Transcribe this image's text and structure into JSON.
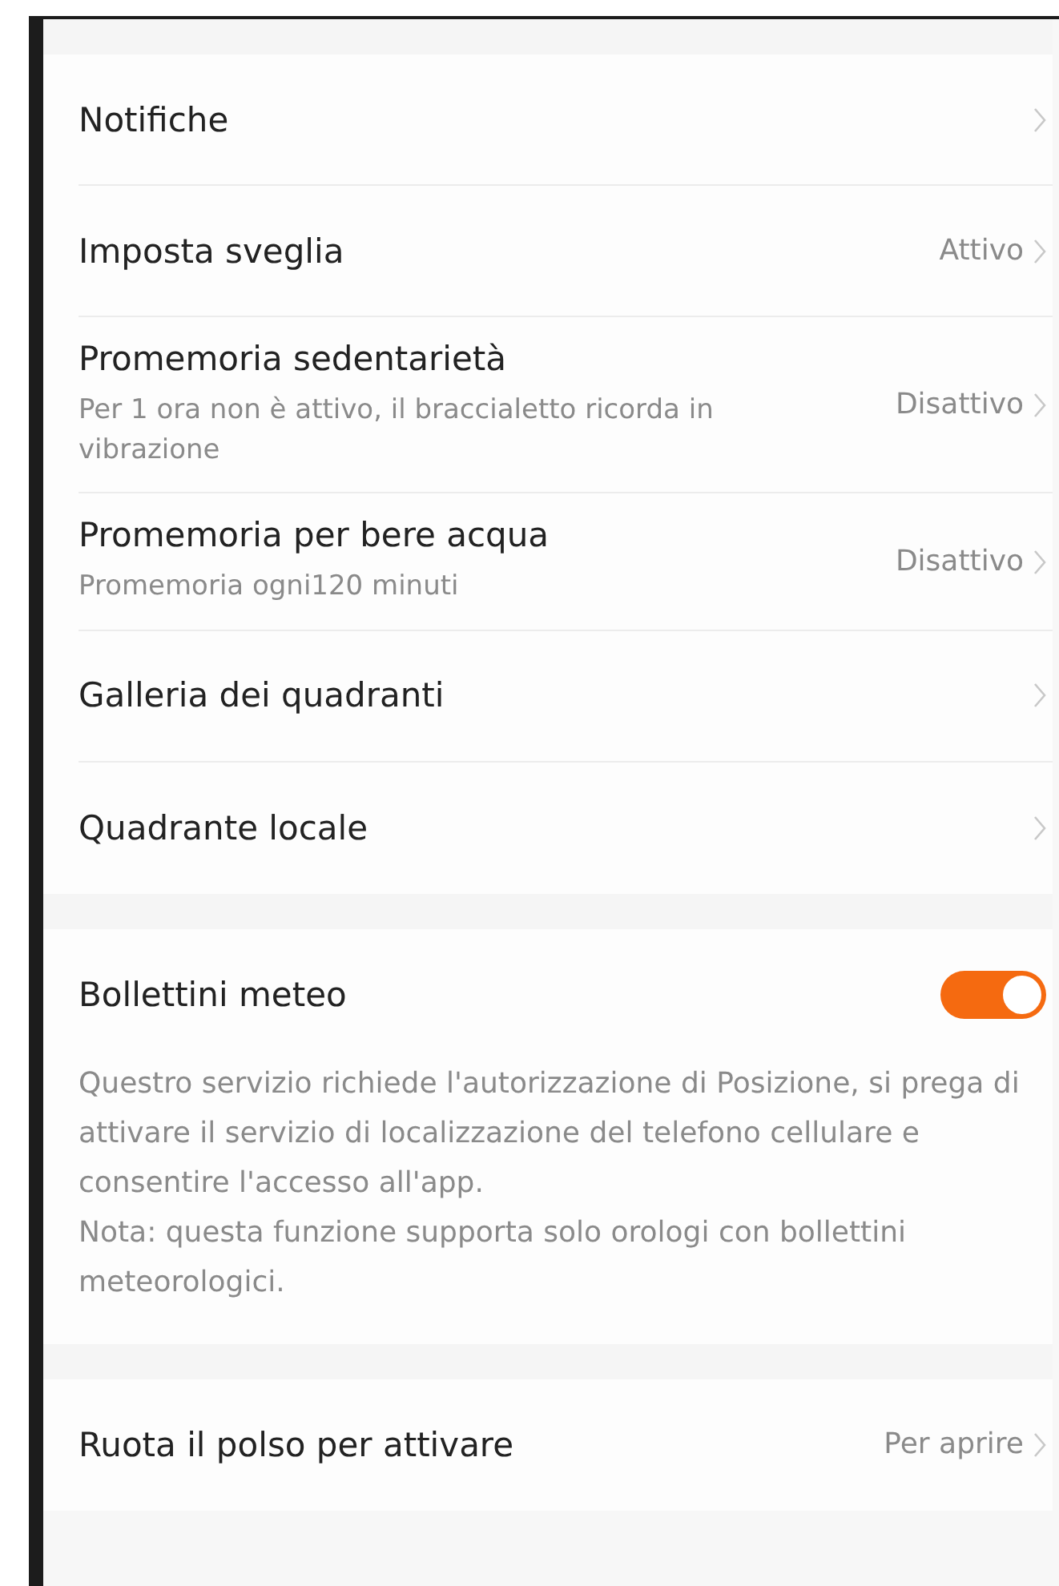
{
  "sections": [
    {
      "items": [
        {
          "kind": "nav",
          "title": "Notifiche"
        },
        {
          "kind": "nav",
          "title": "Imposta sveglia",
          "value": "Attivo"
        },
        {
          "kind": "nav",
          "title": "Promemoria sedentarietà",
          "subtitle": "Per 1 ora non è attivo, il braccialetto ricorda in vibrazione",
          "value": "Disattivo"
        },
        {
          "kind": "nav",
          "title": "Promemoria per bere acqua",
          "subtitle": "Promemoria ogni120 minuti",
          "value": "Disattivo"
        },
        {
          "kind": "nav",
          "title": "Galleria dei quadranti"
        },
        {
          "kind": "nav",
          "title": "Quadrante locale"
        }
      ]
    },
    {
      "items": [
        {
          "kind": "toggle",
          "title": "Bollettini meteo",
          "on": true,
          "description": "Questro servizio richiede l'autorizzazione di Posizione, si prega di attivare il servizio di localizzazione del telefono cellulare e consentire l'accesso all'app.\n Nota: questa funzione supporta solo orologi con bollettini meteorologici."
        }
      ]
    },
    {
      "items": [
        {
          "kind": "nav",
          "title": "Ruota il polso per attivare",
          "value": "Per aprire"
        }
      ]
    }
  ]
}
